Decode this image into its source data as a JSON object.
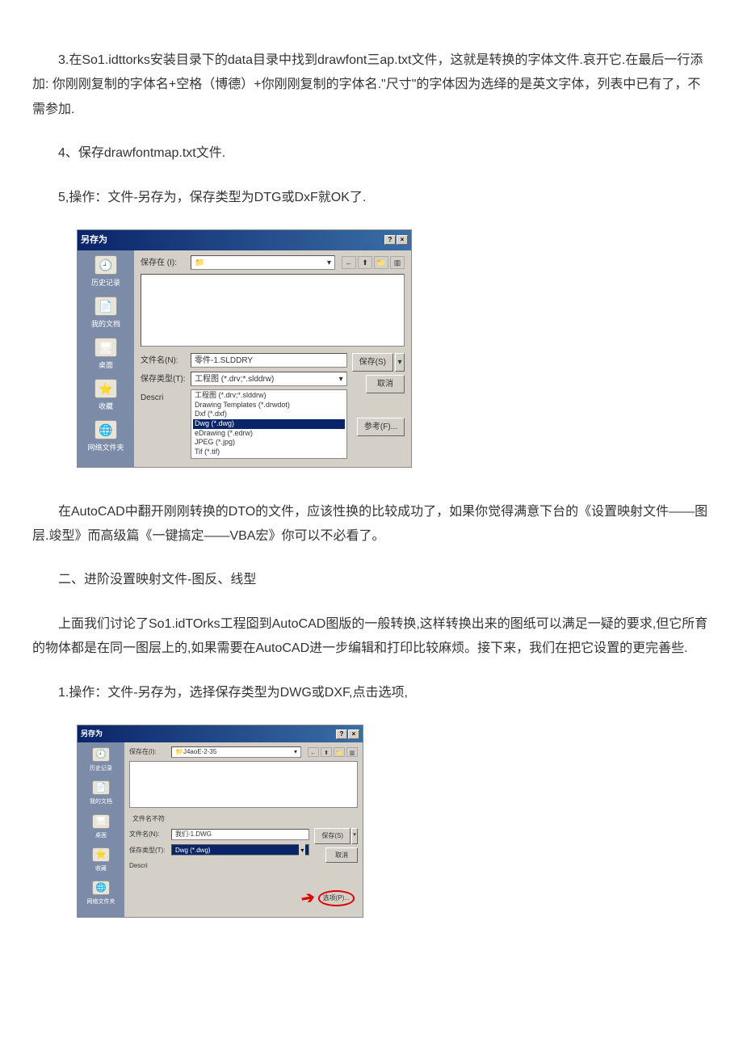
{
  "para1": "3.在So1.idttorks安装目录下的data目录中找到drawfont三ap.txt文件，这就是转换的字体文件.哀开它.在最后一行添加: 你刚刚复制的字体名+空格（博德）+你刚刚复制的字体名.\"尺寸\"的字体因为选绎的是英文字体，列表中已有了，不需参加.",
  "para2": "4、保存drawfontmap.txt文件.",
  "para3": "5,操作：文件-另存为，保存类型为DTG或DxF就OK了.",
  "para4": "在AutoCAD中翻开刚刚转换的DTO的文件，应该性换的比较成功了，如果你觉得满意下台的《设置映射文件——图层.竣型》而高级篇《一键搞定——VBA宏》你可以不必看了。",
  "para5": "二、进阶没置映射文件-图反、线型",
  "para6": "上面我们讨论了So1.idTOrks工程囵到AutoCAD图版的一般转换,这样转换出来的图纸可以满足一疑的要求,但它所育的物体都是在同一图层上的,如果需要在AutoCAD进一步编辑和打印比较麻烦。接下来，我们在把它设置的更完善些.",
  "para7": "1.操作：文件-另存为，选择保存类型为DWG或DXF,点击选项,",
  "dialog1": {
    "title": "另存为",
    "saveInLabel": "保存在 (I):",
    "saveInValue": "",
    "sidebar": {
      "history": "历史记录",
      "myDocs": "我的文档",
      "desktop": "桌面",
      "favorites": "收藏",
      "network": "网络文件夹"
    },
    "filenameLabel": "文件名(N):",
    "filenameValue": "零件-1.SLDDRY",
    "filetypeLabel": "保存类型(T):",
    "filetypeValue": "工程图 (*.drv;*.slddrw)",
    "descriptLabel": "Descri",
    "dropdownItems": {
      "i1": "工程图 (*.drv;*.slddrw)",
      "i2": "Drawing Templates (*.drwdot)",
      "i3": "Dxf (*.dxf)",
      "i4": "Dwg (*.dwg)",
      "i5": "eDrawing (*.edrw)",
      "i6": "JPEG (*.jpg)",
      "i7": "Tif (*.tif)"
    },
    "saveBtn": "保存(S)",
    "cancelBtn": "取消",
    "refBtn": "参考(F)..."
  },
  "dialog2": {
    "title": "另存为",
    "saveInLabel": "保存在(I):",
    "saveInValue": "J4aoE-2-35",
    "sidebar": {
      "history": "历史记录",
      "myDocs": "我的文档",
      "desktop": "桌面",
      "favorites": "收藏",
      "network": "网络文件夹"
    },
    "noteLine": "文件名不符",
    "filenameLabel": "文件名(N):",
    "filenameValue": "我们-1.DWG",
    "filetypeLabel": "保存类型(T):",
    "filetypeValue": "Dwg (*.dwg)",
    "descriptLabel": "Descri",
    "saveBtn": "保存(S)",
    "cancelBtn": "取消",
    "optionBtn": "选项(P)..."
  }
}
